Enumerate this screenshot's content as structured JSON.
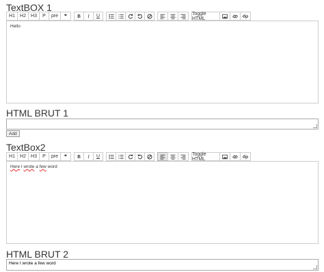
{
  "sections": {
    "textbox1_title": "TextBOX 1",
    "html_brut1_title": "HTML BRUT 1",
    "textbox2_title": "TextBox2",
    "html_brut2_title": "HTML BRUT 2"
  },
  "toolbar": {
    "h1": "H1",
    "h2": "H2",
    "h3": "H3",
    "p": "P",
    "pre": "pre",
    "quote": "❞",
    "bold": "B",
    "italic": "I",
    "underline": "U",
    "toggle_html": "Toggle HTML"
  },
  "editor1": {
    "content": "Hello"
  },
  "raw1": {
    "value": ""
  },
  "add_label": "Add",
  "editor2": {
    "words": [
      "Here",
      "I",
      "wrote",
      "a",
      "few",
      "word"
    ]
  },
  "raw2": {
    "value": "Here I wrote a few word"
  }
}
